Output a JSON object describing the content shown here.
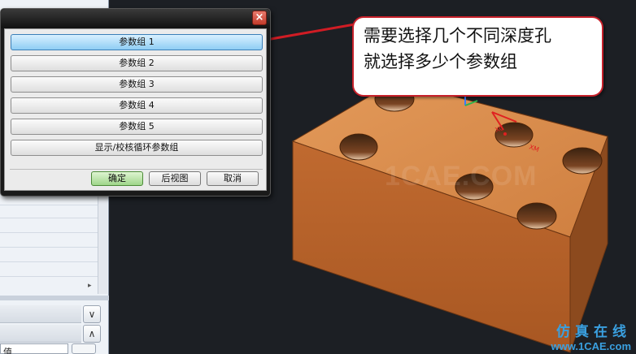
{
  "dialog": {
    "close_label": "×",
    "param_groups": [
      "参数组 1",
      "参数组 2",
      "参数组 3",
      "参数组 4",
      "参数组 5"
    ],
    "loop_button_label": "显示/校核循环参数组",
    "ok_label": "确定",
    "back_view_label": "后视图",
    "cancel_label": "取消"
  },
  "callout": {
    "line1": "需要选择几个不同深度孔",
    "line2": "就选择多少个参数组"
  },
  "side_panel": {
    "collapse_down_icon": "∨",
    "collapse_up_icon": "∧",
    "value_label": "值",
    "scroll_arrow": "▸"
  },
  "viewport": {
    "watermark": "1CAE.COM",
    "logo_line1": "仿真在线",
    "logo_line2": "www.1CAE.com",
    "axis_labels": [
      "XC",
      "XM"
    ]
  },
  "colors": {
    "part_top": "#d88a4c",
    "part_front": "#b8652d",
    "part_side": "#8c4a1e",
    "callout_border": "#c6202a",
    "arrow": "#d01c24"
  }
}
